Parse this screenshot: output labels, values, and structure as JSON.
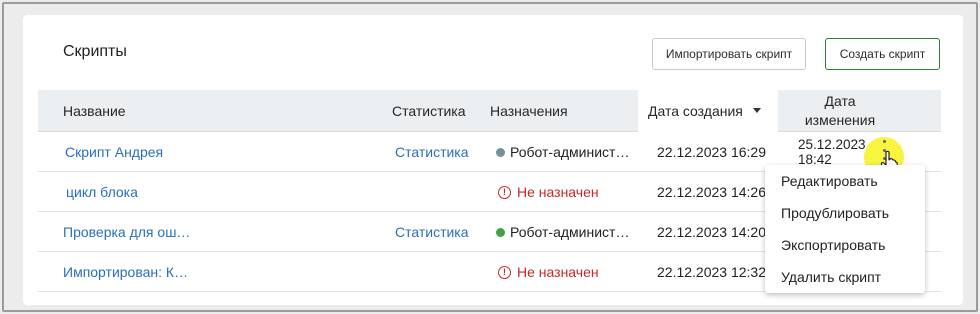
{
  "header": {
    "title": "Скрипты",
    "import_button": "Импортировать скрипт",
    "create_button": "Создать скрипт"
  },
  "table": {
    "columns": {
      "name": "Название",
      "statistics": "Статистика",
      "assignments": "Назначения",
      "created": "Дата создания",
      "modified_line1": "Дата",
      "modified_line2": "изменения"
    },
    "sort": {
      "column": "created",
      "direction": "desc"
    },
    "rows": [
      {
        "name": "Скрипт Андрея",
        "statistics": "Статистика",
        "assignment": "Робот-админист…",
        "assignment_status": "grey",
        "created": "22.12.2023 16:29",
        "modified_date": "25.12.2023",
        "modified_time": "18:42"
      },
      {
        "name": "цикл блока",
        "statistics": "",
        "assignment": "Не назначен",
        "assignment_status": "warning",
        "created": "22.12.2023 14:26"
      },
      {
        "name": "Проверка для ош…",
        "statistics": "Статистика",
        "assignment": "Робот-админист…",
        "assignment_status": "green",
        "created": "22.12.2023 14:20"
      },
      {
        "name": "Импортирован: К…",
        "statistics": "",
        "assignment": "Не назначен",
        "assignment_status": "warning",
        "created": "22.12.2023 12:32"
      }
    ]
  },
  "status_colors": {
    "grey": "#78909c",
    "green": "#43a047",
    "warning": "#c62828"
  },
  "context_menu": {
    "items": [
      "Редактировать",
      "Продублировать",
      "Экспортировать",
      "Удалить скрипт"
    ]
  },
  "icons": {
    "row_actions": "kebab-menu-icon",
    "warning": "warning-circle-icon",
    "cursor": "hand-pointer-icon"
  }
}
